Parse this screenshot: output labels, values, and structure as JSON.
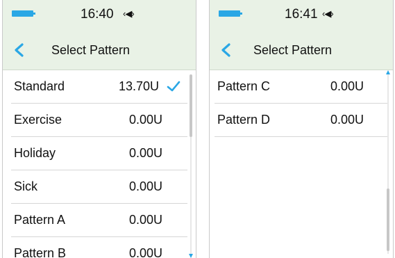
{
  "colors": {
    "accent": "#2aa7e5",
    "header_bg": "#e9f2e6",
    "divider": "#d6d6d6"
  },
  "screens": [
    {
      "status": {
        "time": "16:40",
        "battery_icon": "battery-icon",
        "vibrate_icon": "vibrate-icon"
      },
      "header": {
        "title": "Select Pattern",
        "back_icon": "back-chevron-icon"
      },
      "rows": [
        {
          "label": "Standard",
          "value": "13.70U",
          "selected": true
        },
        {
          "label": "Exercise",
          "value": "0.00U"
        },
        {
          "label": "Holiday",
          "value": "0.00U"
        },
        {
          "label": "Sick",
          "value": "0.00U"
        },
        {
          "label": "Pattern A",
          "value": "0.00U"
        },
        {
          "label": "Pattern B",
          "value": "0.00U"
        }
      ],
      "scroll_position": 0.0
    },
    {
      "status": {
        "time": "16:41",
        "battery_icon": "battery-icon",
        "vibrate_icon": "vibrate-icon"
      },
      "header": {
        "title": "Select Pattern",
        "back_icon": "back-chevron-icon"
      },
      "rows": [
        {
          "label": "Pattern C",
          "value": "0.00U"
        },
        {
          "label": "Pattern D",
          "value": "0.00U"
        }
      ],
      "scroll_position": 1.0
    }
  ]
}
